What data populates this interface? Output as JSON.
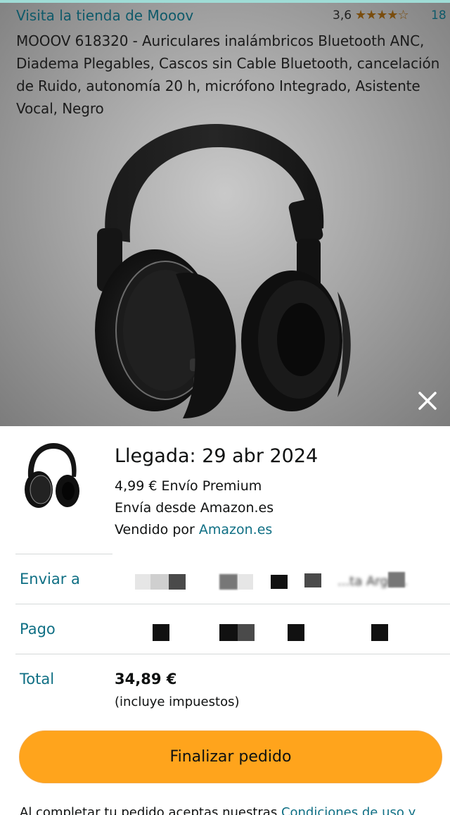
{
  "product": {
    "store_link": "Visita la tienda de Mooov",
    "rating": "3,6",
    "stars": "★★★★☆",
    "review_count": "18",
    "title": "MOOOV 618320 - Auriculares inalámbricos Bluetooth ANC, Diadema Plegables, Cascos sin Cable Bluetooth, cancelación de Ruido, autonomía 20 h, micrófono Integrado, Asistente Vocal, Negro",
    "close_icon": "close-icon"
  },
  "order": {
    "delivery": "Llegada: 29 abr 2024",
    "shipping": "4,99 € Envío Premium",
    "ships_from": "Envía desde Amazon.es",
    "sold_by_prefix": "Vendido por ",
    "sold_by": "Amazon.es",
    "ship_to_label": "Enviar a",
    "ship_to_value_visible": "...ta Argo...",
    "payment_label": "Pago",
    "total_label": "Total",
    "total_amount": "34,89 €",
    "total_note": "(incluye impuestos)",
    "checkout_button": "Finalizar pedido",
    "legal_prefix": "Al completar tu pedido aceptas nuestras ",
    "legal_link": "Condiciones de uso y"
  },
  "colors": {
    "link": "#0f6f84",
    "button": "#ffa41c",
    "stars": "#7a4d0e"
  }
}
